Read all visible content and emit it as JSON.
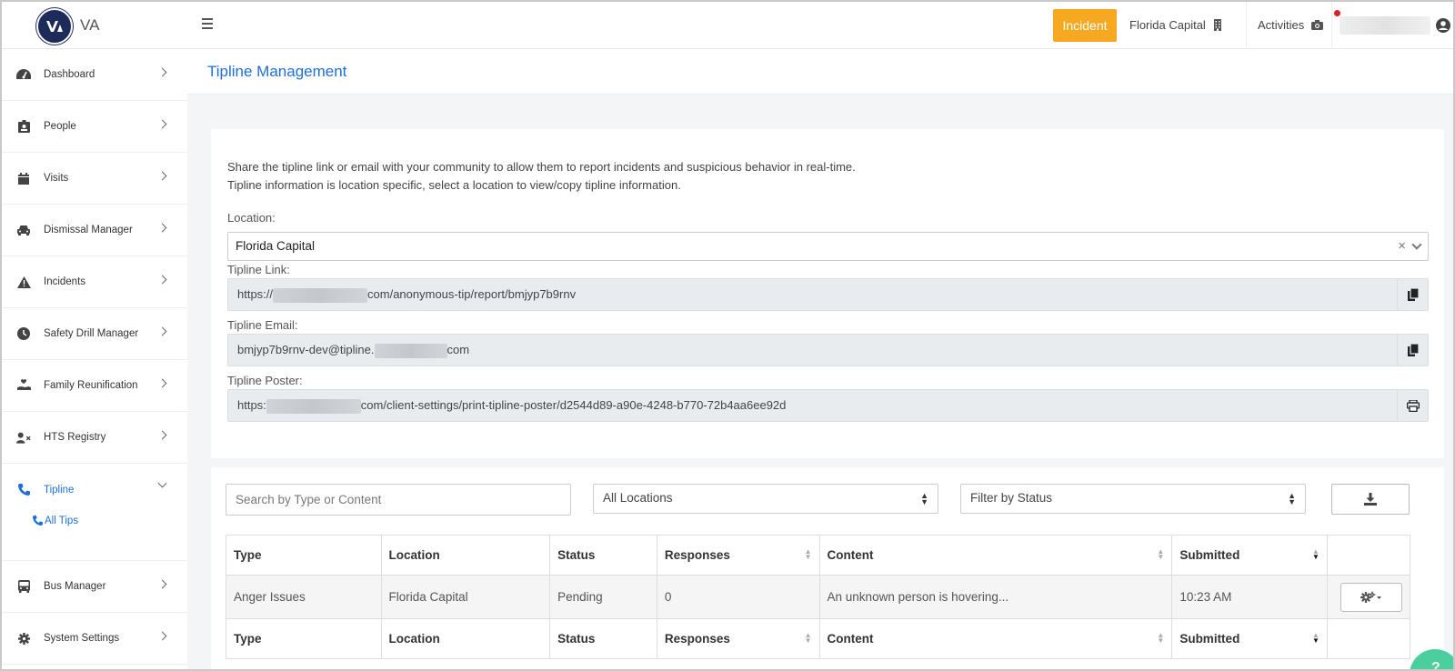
{
  "header": {
    "brand": "VA",
    "incident_label": "Incident",
    "location": "Florida Capital",
    "activities": "Activities"
  },
  "sidebar": {
    "items": [
      {
        "label": "Dashboard",
        "icon": "dashboard-icon"
      },
      {
        "label": "People",
        "icon": "id-badge-icon"
      },
      {
        "label": "Visits",
        "icon": "calendar-icon"
      },
      {
        "label": "Dismissal Manager",
        "icon": "car-icon"
      },
      {
        "label": "Incidents",
        "icon": "warning-icon"
      },
      {
        "label": "Safety Drill Manager",
        "icon": "clock-icon"
      },
      {
        "label": "Family Reunification",
        "icon": "hand-heart-icon"
      },
      {
        "label": "HTS Registry",
        "icon": "user-x-icon"
      },
      {
        "label": "Tipline",
        "icon": "phone-icon"
      },
      {
        "label": "Bus Manager",
        "icon": "bus-icon"
      },
      {
        "label": "System Settings",
        "icon": "gear-icon"
      }
    ],
    "sub_all_tips": "All Tips"
  },
  "page": {
    "title": "Tipline Management"
  },
  "info": {
    "line1": "Share the tipline link or email with your community to allow them to report incidents and suspicious behavior in real-time.",
    "line2": "Tipline information is location specific, select a location to view/copy tipline information.",
    "location_label": "Location:",
    "location_value": "Florida Capital",
    "link_label": "Tipline Link:",
    "link_prefix": "https://",
    "link_suffix": "com/anonymous-tip/report/bmjyp7b9rnv",
    "email_label": "Tipline Email:",
    "email_prefix": "bmjyp7b9rnv-dev@tipline.",
    "email_suffix": "com",
    "poster_label": "Tipline Poster:",
    "poster_prefix": "https:",
    "poster_suffix": "com/client-settings/print-tipline-poster/d2544d89-a90e-4248-b770-72b4aa6ee92d"
  },
  "filters": {
    "search_placeholder": "Search by Type or Content",
    "locations": "All Locations",
    "status": "Filter by Status"
  },
  "table": {
    "columns": [
      "Type",
      "Location",
      "Status",
      "Responses",
      "Content",
      "Submitted"
    ],
    "rows": [
      {
        "type": "Anger Issues",
        "location": "Florida Capital",
        "status": "Pending",
        "responses": "0",
        "content": "An unknown person is hovering...",
        "submitted": "10:23 AM"
      }
    ]
  },
  "help": "?"
}
